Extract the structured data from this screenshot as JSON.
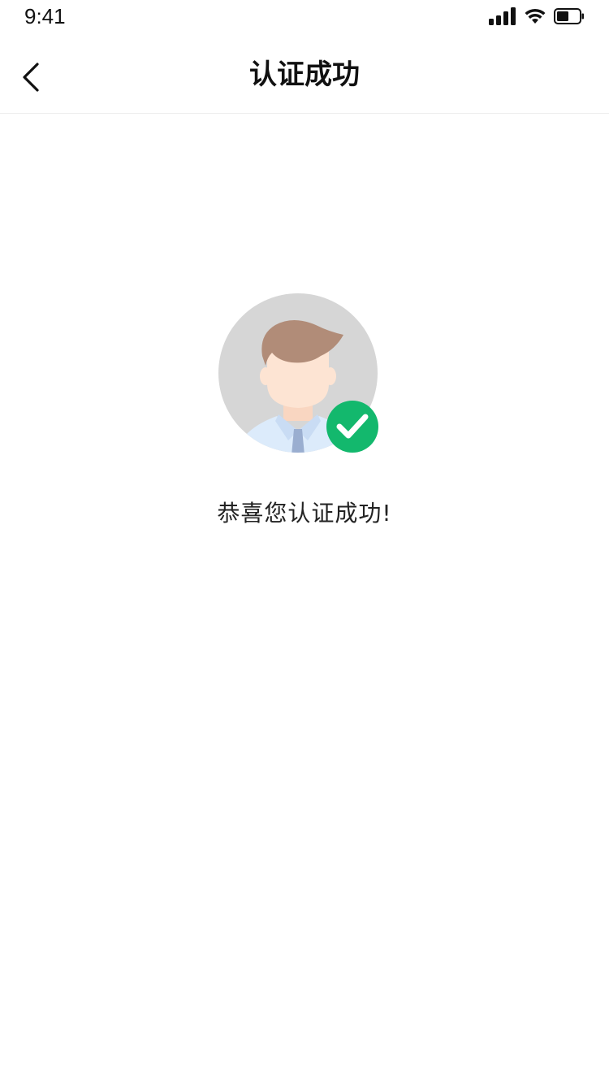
{
  "status_bar": {
    "time": "9:41",
    "icons": [
      "cellular-signal-icon",
      "wifi-icon",
      "battery-icon"
    ]
  },
  "nav": {
    "back_icon": "chevron-left-icon",
    "title": "认证成功"
  },
  "main": {
    "avatar_icon": "user-avatar-icon",
    "badge_icon": "checkmark-icon",
    "message": "恭喜您认证成功!"
  },
  "colors": {
    "background": "#ffffff",
    "avatar_circle": "#d6d6d6",
    "hair": "#b18c78",
    "skin": "#fde4d3",
    "shirt": "#dcebfb",
    "tie": "#9aaed0",
    "success_green": "#13b86d",
    "divider": "#eeeeee"
  }
}
